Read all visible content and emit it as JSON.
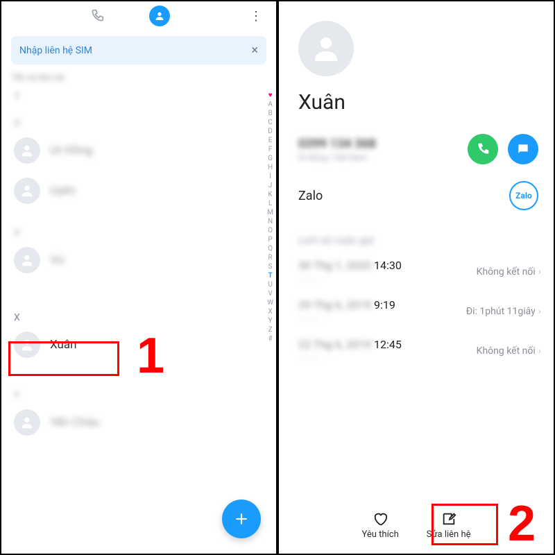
{
  "annotations": {
    "step1": "1",
    "step2": "2"
  },
  "left": {
    "chip_label": "Nhập liên hệ SIM",
    "filter_label": "Tất cả liên hệ",
    "sections": {
      "t": "T",
      "u": "U",
      "v": "V",
      "x": "X",
      "y": "Y"
    },
    "contacts": {
      "u1": "Ut Hồng",
      "u2": "Uyên",
      "v1": "Vợ",
      "x1": "Xuân",
      "y1": "Yến Châu"
    },
    "index_rail": [
      "A",
      "B",
      "C",
      "D",
      "E",
      "F",
      "G",
      "H",
      "I",
      "J",
      "K",
      "L",
      "M",
      "N",
      "O",
      "P",
      "Q",
      "R",
      "S",
      "T",
      "U",
      "V",
      "W",
      "X",
      "Y",
      "Z",
      "#"
    ]
  },
  "right": {
    "contact_name": "Xuân",
    "phone": "0399 134 368",
    "phone_sub": "Di động | Việt Nam",
    "app_label": "Zalo",
    "zalo_text": "Zalo",
    "history_header": "Lịch sử cuộc gọi",
    "history": [
      {
        "date_dim": "30 Thg 1, 2020",
        "time": "14:30",
        "status": "Không kết nối"
      },
      {
        "date_dim": "29 Thg 6, 2019",
        "time": "9:19",
        "status": "Đi: 1phút 11giây"
      },
      {
        "date_dim": "22 Thg 6, 2019",
        "time": "12:45",
        "status": "Không kết nối"
      }
    ],
    "bottom": {
      "fav": "Yêu thích",
      "edit": "Sửa liên hệ"
    }
  },
  "colors": {
    "accent": "#1a9cff",
    "call": "#2fc96a",
    "red": "#ff0000"
  }
}
